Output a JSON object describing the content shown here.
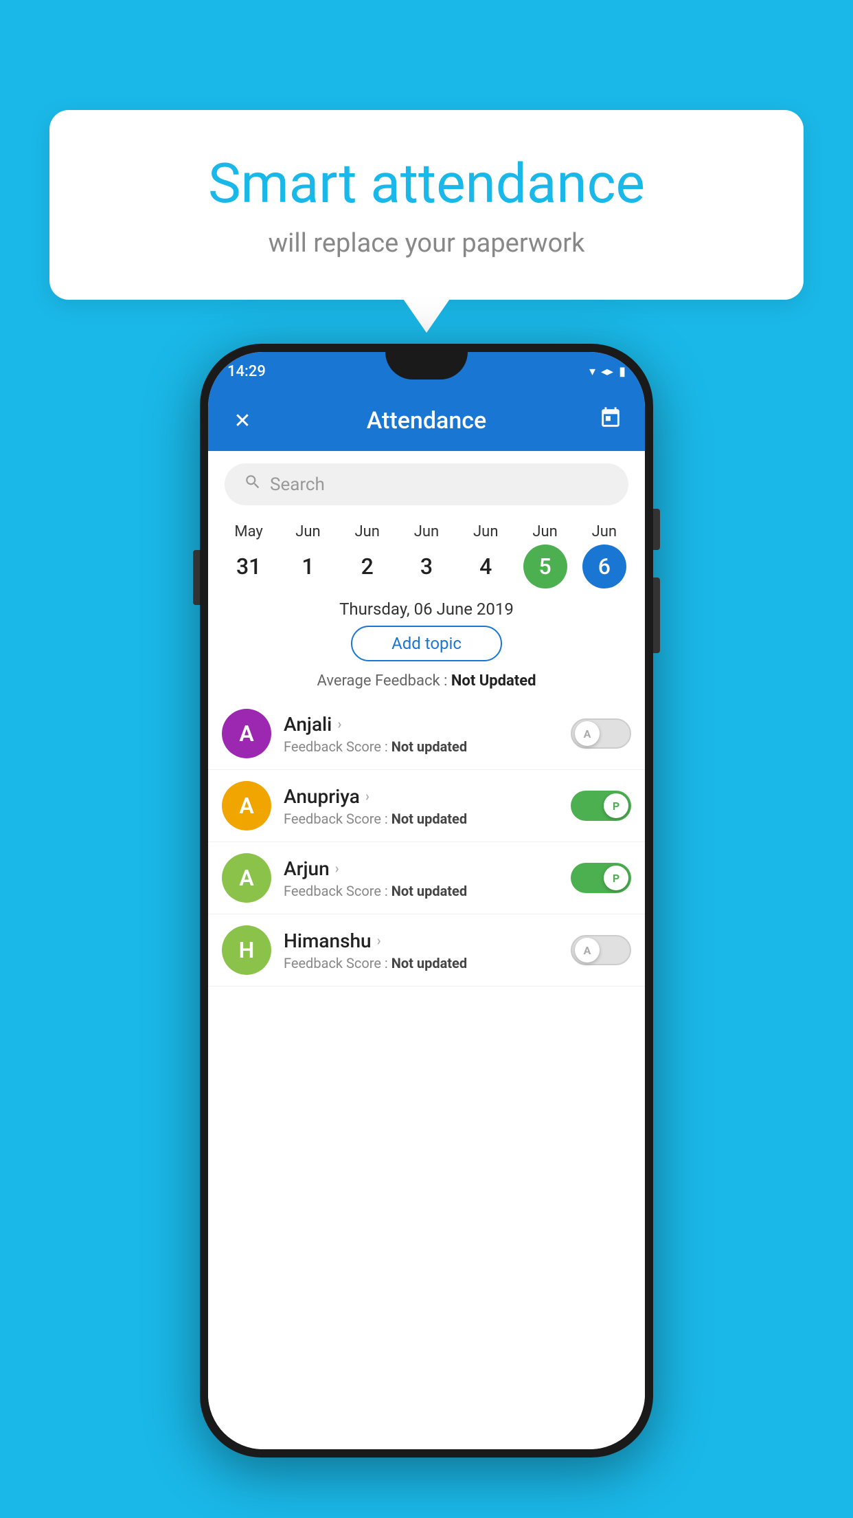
{
  "background_color": "#1ab8e8",
  "bubble": {
    "title": "Smart attendance",
    "subtitle": "will replace your paperwork"
  },
  "status_bar": {
    "time": "14:29",
    "signal_icon": "▼◄",
    "battery_icon": "▮"
  },
  "app_bar": {
    "title": "Attendance",
    "close_label": "✕",
    "calendar_label": "📅"
  },
  "search": {
    "placeholder": "Search"
  },
  "calendar": {
    "days": [
      {
        "month": "May",
        "day": "31",
        "state": "normal"
      },
      {
        "month": "Jun",
        "day": "1",
        "state": "normal"
      },
      {
        "month": "Jun",
        "day": "2",
        "state": "normal"
      },
      {
        "month": "Jun",
        "day": "3",
        "state": "normal"
      },
      {
        "month": "Jun",
        "day": "4",
        "state": "normal"
      },
      {
        "month": "Jun",
        "day": "5",
        "state": "today"
      },
      {
        "month": "Jun",
        "day": "6",
        "state": "selected"
      }
    ]
  },
  "selected_date": "Thursday, 06 June 2019",
  "add_topic_label": "Add topic",
  "avg_feedback_label": "Average Feedback :",
  "avg_feedback_value": "Not Updated",
  "students": [
    {
      "name": "Anjali",
      "avatar_letter": "A",
      "avatar_color": "#9c27b0",
      "feedback_label": "Feedback Score :",
      "feedback_value": "Not updated",
      "toggle": "off",
      "toggle_letter": "A"
    },
    {
      "name": "Anupriya",
      "avatar_letter": "A",
      "avatar_color": "#f0a500",
      "feedback_label": "Feedback Score :",
      "feedback_value": "Not updated",
      "toggle": "on",
      "toggle_letter": "P"
    },
    {
      "name": "Arjun",
      "avatar_letter": "A",
      "avatar_color": "#8bc34a",
      "feedback_label": "Feedback Score :",
      "feedback_value": "Not updated",
      "toggle": "on",
      "toggle_letter": "P"
    },
    {
      "name": "Himanshu",
      "avatar_letter": "H",
      "avatar_color": "#8bc34a",
      "feedback_label": "Feedback Score :",
      "feedback_value": "Not updated",
      "toggle": "off",
      "toggle_letter": "A"
    }
  ]
}
